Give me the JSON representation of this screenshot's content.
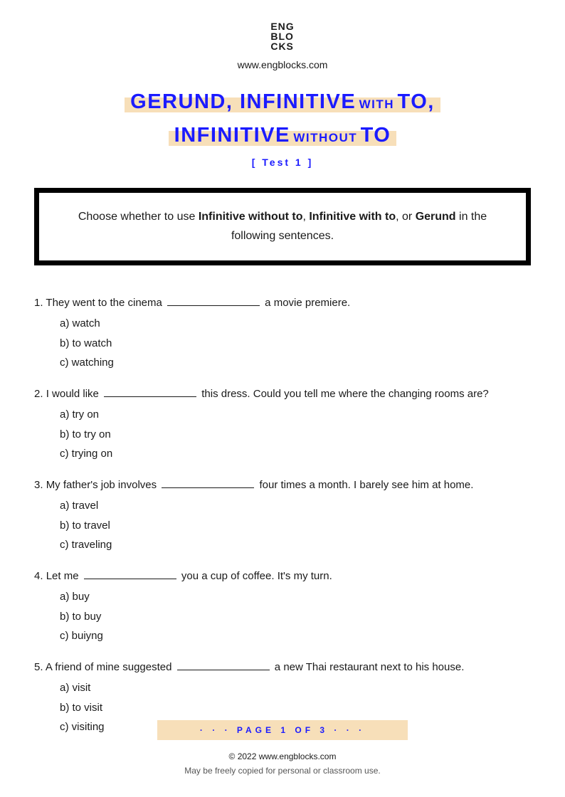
{
  "header": {
    "logo_l1": "ENG",
    "logo_l2": "BLO",
    "logo_l3": "CKS",
    "website": "www.engblocks.com"
  },
  "title": {
    "l1_big1": "GERUND, INFINITIVE",
    "l1_sm1": "WITH",
    "l1_big2": "TO",
    "l1_comma": ",",
    "l2_big1": "INFINITIVE",
    "l2_sm1": "WITHOUT",
    "l2_big2": "TO",
    "subtitle": "[ Test 1 ]"
  },
  "instructions": {
    "pre": "Choose whether to use ",
    "b1": "Infinitive without to",
    "mid1": ", ",
    "b2": "Infinitive with to",
    "mid2": ", or ",
    "b3": "Gerund",
    "post": " in the following sentences."
  },
  "questions": [
    {
      "num": "1.",
      "before": "They went to the cinema ",
      "after": " a movie premiere.",
      "a": "a) watch",
      "b": "b) to watch",
      "c": "c) watching"
    },
    {
      "num": "2.",
      "before": "I would like ",
      "after": " this dress. Could you tell me where the changing rooms are?",
      "a": "a) try on",
      "b": "b) to try on",
      "c": "c) trying on"
    },
    {
      "num": "3.",
      "before": "My father's job involves ",
      "after": " four times a month. I barely see him at home.",
      "a": "a) travel",
      "b": "b) to travel",
      "c": "c) traveling"
    },
    {
      "num": "4.",
      "before": "Let me ",
      "after": " you a cup of coffee. It's my turn.",
      "a": "a) buy",
      "b": "b) to buy",
      "c": "c) buiyng"
    },
    {
      "num": "5.",
      "before": "A friend of mine suggested ",
      "after": " a new Thai restaurant next to his house.",
      "a": "a) visit",
      "b": "b) to visit",
      "c": "c) visiting"
    }
  ],
  "footer": {
    "pager_dots_l": "· · ·   ",
    "pager_label": "PAGE ",
    "pager_cur": "1",
    "pager_of": " OF ",
    "pager_total": "3",
    "pager_dots_r": "   · · ·",
    "copyright": "© 2022 www.engblocks.com",
    "license": "May be freely copied for personal or classroom use."
  }
}
